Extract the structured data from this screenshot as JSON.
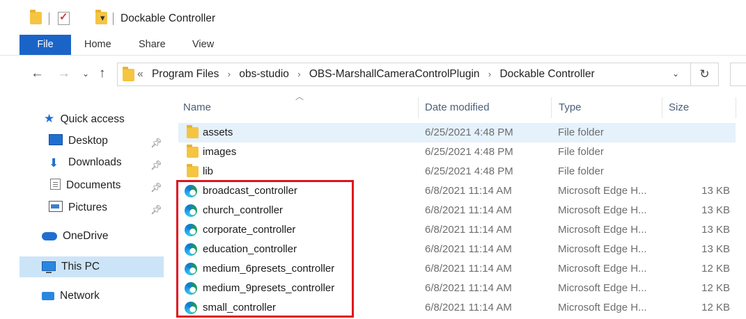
{
  "window": {
    "title": "Dockable Controller"
  },
  "ribbon": {
    "tabs": [
      "File",
      "Home",
      "Share",
      "View"
    ]
  },
  "address": {
    "overflow": "«",
    "crumbs": [
      "Program Files",
      "obs-studio",
      "OBS-MarshallCameraControlPlugin",
      "Dockable Controller"
    ]
  },
  "nav": {
    "quick_access": "Quick access",
    "desktop": "Desktop",
    "downloads": "Downloads",
    "documents": "Documents",
    "pictures": "Pictures",
    "onedrive": "OneDrive",
    "this_pc": "This PC",
    "network": "Network"
  },
  "columns": {
    "name": "Name",
    "date": "Date modified",
    "type": "Type",
    "size": "Size"
  },
  "files": [
    {
      "name": "assets",
      "date": "6/25/2021 4:48 PM",
      "type": "File folder",
      "size": "",
      "kind": "folder"
    },
    {
      "name": "images",
      "date": "6/25/2021 4:48 PM",
      "type": "File folder",
      "size": "",
      "kind": "folder"
    },
    {
      "name": "lib",
      "date": "6/25/2021 4:48 PM",
      "type": "File folder",
      "size": "",
      "kind": "folder"
    },
    {
      "name": "broadcast_controller",
      "date": "6/8/2021 11:14 AM",
      "type": "Microsoft Edge H...",
      "size": "13 KB",
      "kind": "edge"
    },
    {
      "name": "church_controller",
      "date": "6/8/2021 11:14 AM",
      "type": "Microsoft Edge H...",
      "size": "13 KB",
      "kind": "edge"
    },
    {
      "name": "corporate_controller",
      "date": "6/8/2021 11:14 AM",
      "type": "Microsoft Edge H...",
      "size": "13 KB",
      "kind": "edge"
    },
    {
      "name": "education_controller",
      "date": "6/8/2021 11:14 AM",
      "type": "Microsoft Edge H...",
      "size": "13 KB",
      "kind": "edge"
    },
    {
      "name": "medium_6presets_controller",
      "date": "6/8/2021 11:14 AM",
      "type": "Microsoft Edge H...",
      "size": "12 KB",
      "kind": "edge"
    },
    {
      "name": "medium_9presets_controller",
      "date": "6/8/2021 11:14 AM",
      "type": "Microsoft Edge H...",
      "size": "12 KB",
      "kind": "edge"
    },
    {
      "name": "small_controller",
      "date": "6/8/2021 11:14 AM",
      "type": "Microsoft Edge H...",
      "size": "12 KB",
      "kind": "edge"
    }
  ]
}
